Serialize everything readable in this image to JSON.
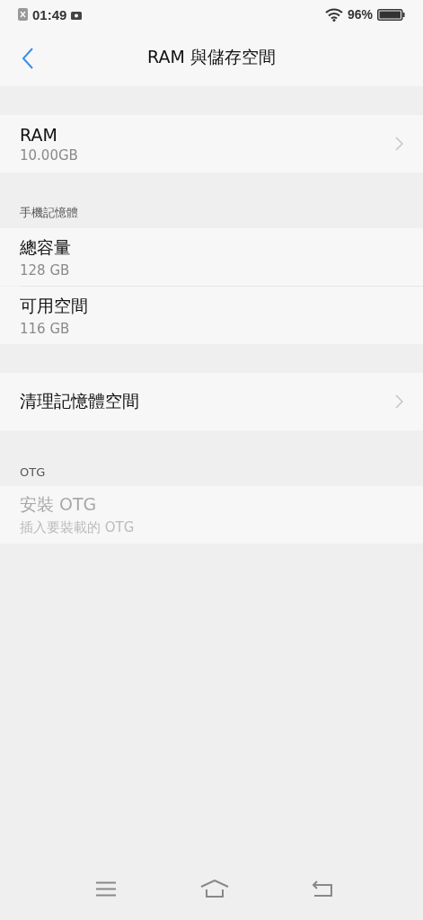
{
  "status_bar": {
    "time": "01:49",
    "battery_percent": "96%"
  },
  "header": {
    "title": "RAM 與儲存空間"
  },
  "sections": [
    {
      "rows": [
        {
          "title": "RAM",
          "subtitle": "10.00GB",
          "chevron": true,
          "disabled": false
        }
      ]
    },
    {
      "heading": "手機記憶體",
      "rows": [
        {
          "title": "總容量",
          "subtitle": "128 GB",
          "chevron": false,
          "disabled": false
        },
        {
          "title": "可用空間",
          "subtitle": "116 GB",
          "chevron": false,
          "disabled": false
        }
      ]
    },
    {
      "rows": [
        {
          "title": "清理記憶體空間",
          "chevron": true,
          "disabled": false
        }
      ]
    },
    {
      "heading": "OTG",
      "rows": [
        {
          "title": "安裝 OTG",
          "subtitle": "插入要裝載的 OTG",
          "chevron": false,
          "disabled": true
        }
      ]
    }
  ]
}
